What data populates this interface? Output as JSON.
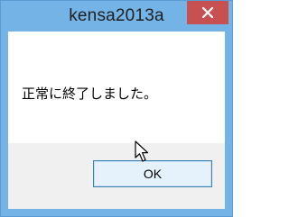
{
  "window": {
    "title": "kensa2013a",
    "close_icon": "close-icon"
  },
  "dialog": {
    "message": "正常に終了しました。",
    "ok_label": "OK"
  },
  "colors": {
    "titlebar": "#73b3e6",
    "close_button": "#c75050",
    "footer": "#f0f0f0",
    "button_border": "#3c7fb1",
    "button_fill": "#e5f1fb"
  },
  "cursor_icon": "mouse-pointer-icon"
}
